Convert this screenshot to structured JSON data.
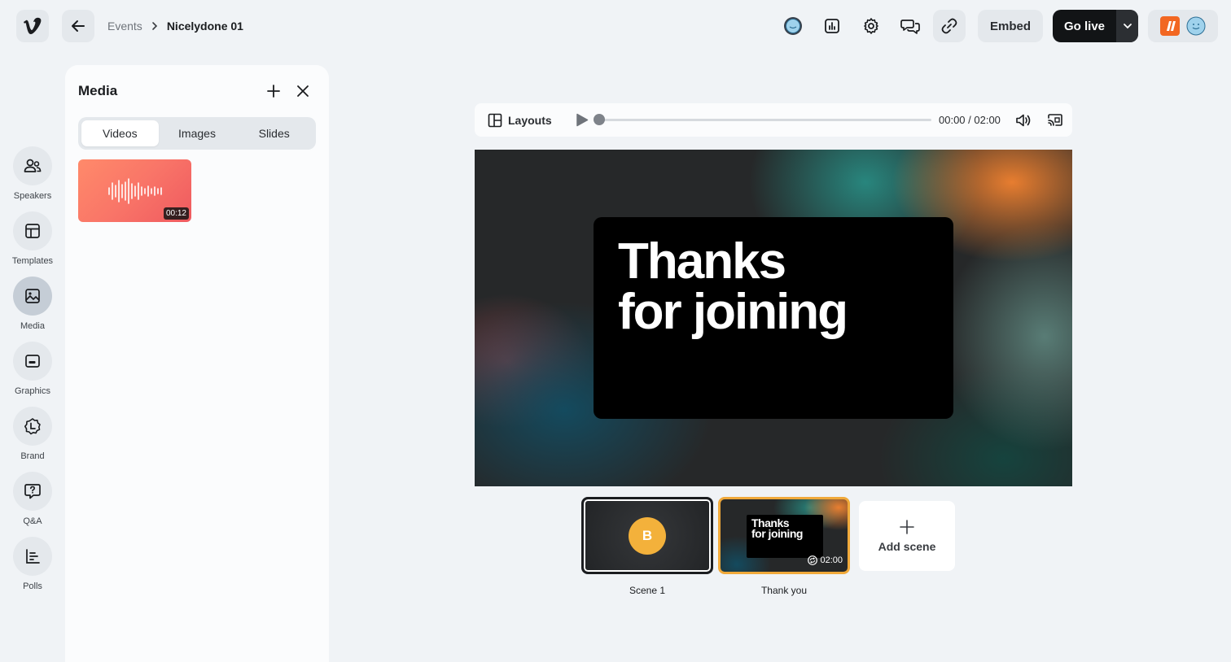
{
  "header": {
    "logo_icon": "vimeo-logo-icon",
    "back_icon": "arrow-left-icon",
    "breadcrumb": {
      "parent": "Events",
      "current": "Nicelydone 01"
    },
    "icons": [
      "avatar-status-icon",
      "analytics-icon",
      "settings-icon",
      "chat-icon",
      "link-icon"
    ],
    "embed_label": "Embed",
    "go_live_label": "Go live",
    "accent_color": "#121416"
  },
  "rail": {
    "items": [
      {
        "label": "Speakers",
        "icon": "users-icon"
      },
      {
        "label": "Templates",
        "icon": "layout-icon"
      },
      {
        "label": "Media",
        "icon": "image-icon",
        "active": true
      },
      {
        "label": "Graphics",
        "icon": "graphics-icon"
      },
      {
        "label": "Brand",
        "icon": "brand-icon"
      },
      {
        "label": "Q&A",
        "icon": "question-icon"
      },
      {
        "label": "Polls",
        "icon": "poll-icon"
      }
    ]
  },
  "media_panel": {
    "title": "Media",
    "tabs": [
      {
        "label": "Videos",
        "active": true
      },
      {
        "label": "Images"
      },
      {
        "label": "Slides"
      }
    ],
    "videos": [
      {
        "duration": "00:12",
        "gradient_color": "#f97568"
      }
    ]
  },
  "player": {
    "layouts_label": "Layouts",
    "time": "00:00 / 02:00",
    "progress": 0
  },
  "stage": {
    "line1": "Thanks",
    "line2": "for joining"
  },
  "scenes": [
    {
      "label": "Scene 1",
      "avatar_initial": "B",
      "avatar_color": "#f3b13b"
    },
    {
      "label": "Thank you",
      "mini_line1": "Thanks",
      "mini_line2": "for joining",
      "duration": "02:00",
      "selected_color": "#f0a93a"
    }
  ],
  "add_scene_label": "Add scene"
}
